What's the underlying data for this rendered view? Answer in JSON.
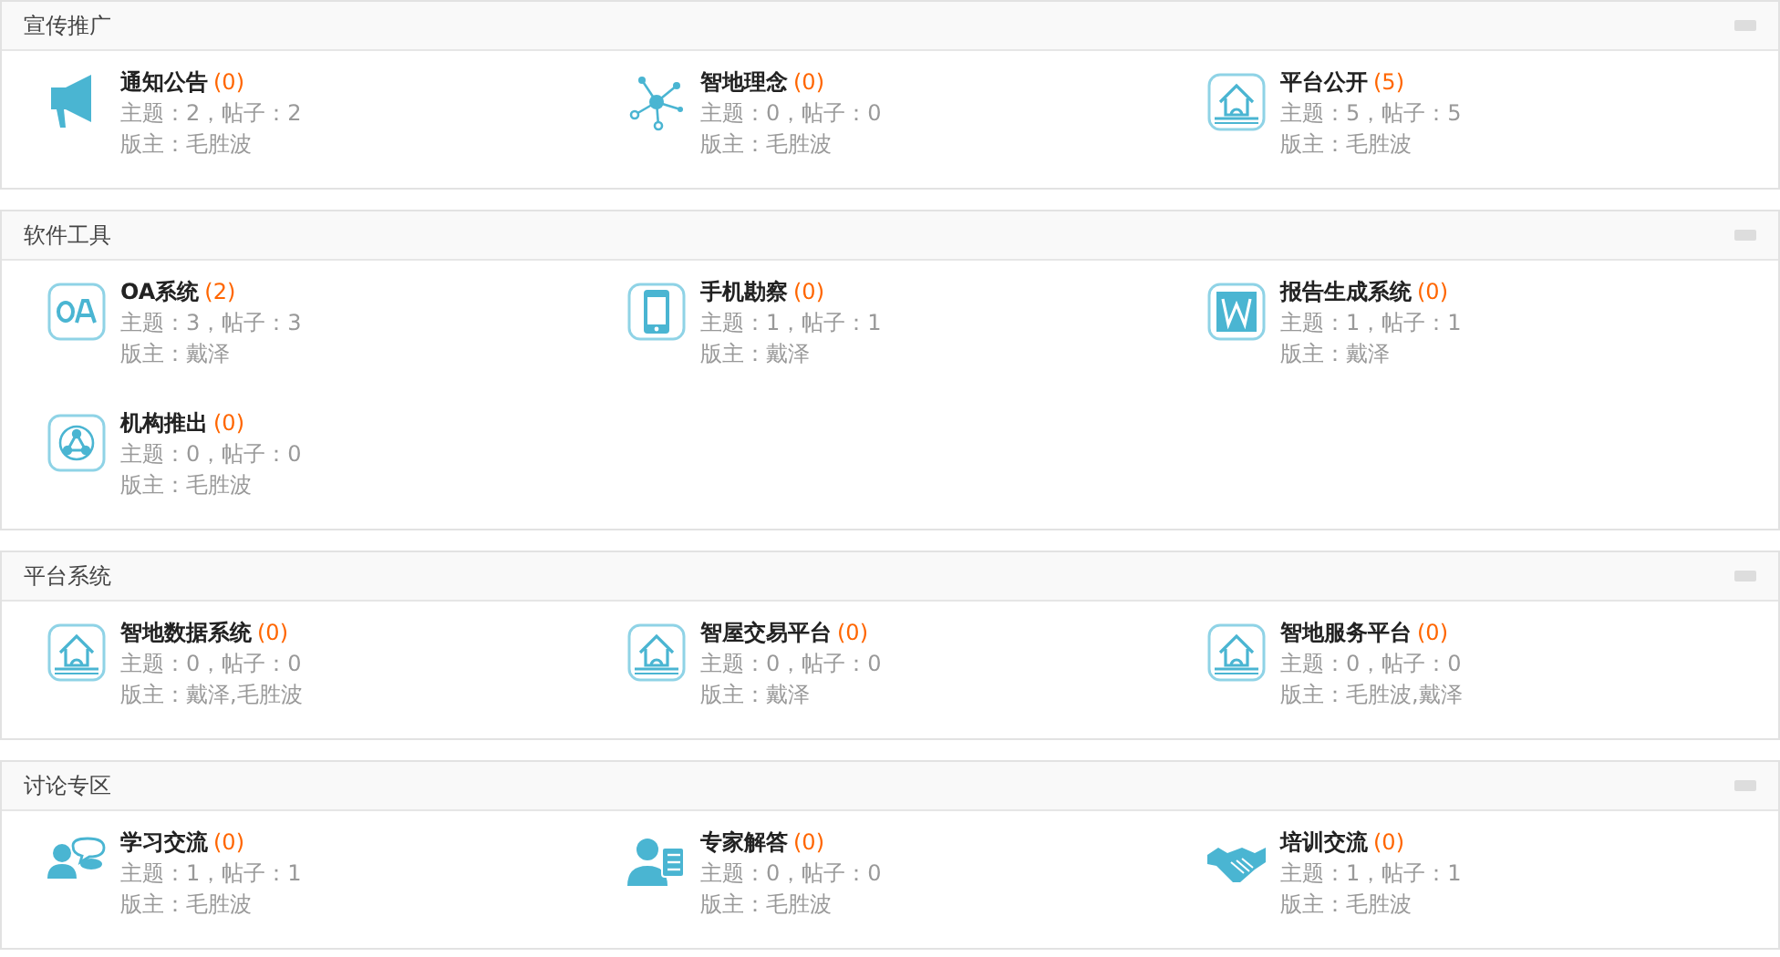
{
  "sections": [
    {
      "title": "宣传推广",
      "forums": [
        {
          "kind": "megaphone",
          "name": "通知公告",
          "count": "(0)",
          "stats": "主题：2，帖子：2",
          "moderator": "版主：毛胜波"
        },
        {
          "kind": "network",
          "name": "智地理念",
          "count": "(0)",
          "stats": "主题：0，帖子：0",
          "moderator": "版主：毛胜波"
        },
        {
          "kind": "house",
          "name": "平台公开",
          "count": "(5)",
          "stats": "主题：5，帖子：5",
          "moderator": "版主：毛胜波"
        }
      ]
    },
    {
      "title": "软件工具",
      "forums": [
        {
          "kind": "oa",
          "name": "OA系统",
          "count": "(2)",
          "stats": "主题：3，帖子：3",
          "moderator": "版主：戴泽"
        },
        {
          "kind": "phone",
          "name": "手机勘察",
          "count": "(0)",
          "stats": "主题：1，帖子：1",
          "moderator": "版主：戴泽"
        },
        {
          "kind": "word",
          "name": "报告生成系统",
          "count": "(0)",
          "stats": "主题：1，帖子：1",
          "moderator": "版主：戴泽"
        },
        {
          "kind": "share",
          "name": "机构推出",
          "count": "(0)",
          "stats": "主题：0，帖子：0",
          "moderator": "版主：毛胜波"
        }
      ]
    },
    {
      "title": "平台系统",
      "forums": [
        {
          "kind": "house",
          "name": "智地数据系统",
          "count": "(0)",
          "stats": "主题：0，帖子：0",
          "moderator": "版主：戴泽,毛胜波"
        },
        {
          "kind": "house",
          "name": "智屋交易平台",
          "count": "(0)",
          "stats": "主题：0，帖子：0",
          "moderator": "版主：戴泽"
        },
        {
          "kind": "house",
          "name": "智地服务平台",
          "count": "(0)",
          "stats": "主题：0，帖子：0",
          "moderator": "版主：毛胜波,戴泽"
        }
      ]
    },
    {
      "title": "讨论专区",
      "forums": [
        {
          "kind": "chat",
          "name": "学习交流",
          "count": "(0)",
          "stats": "主题：1，帖子：1",
          "moderator": "版主：毛胜波"
        },
        {
          "kind": "expert",
          "name": "专家解答",
          "count": "(0)",
          "stats": "主题：0，帖子：0",
          "moderator": "版主：毛胜波"
        },
        {
          "kind": "handshake",
          "name": "培训交流",
          "count": "(0)",
          "stats": "主题：1，帖子：1",
          "moderator": "版主：毛胜波"
        }
      ]
    }
  ]
}
